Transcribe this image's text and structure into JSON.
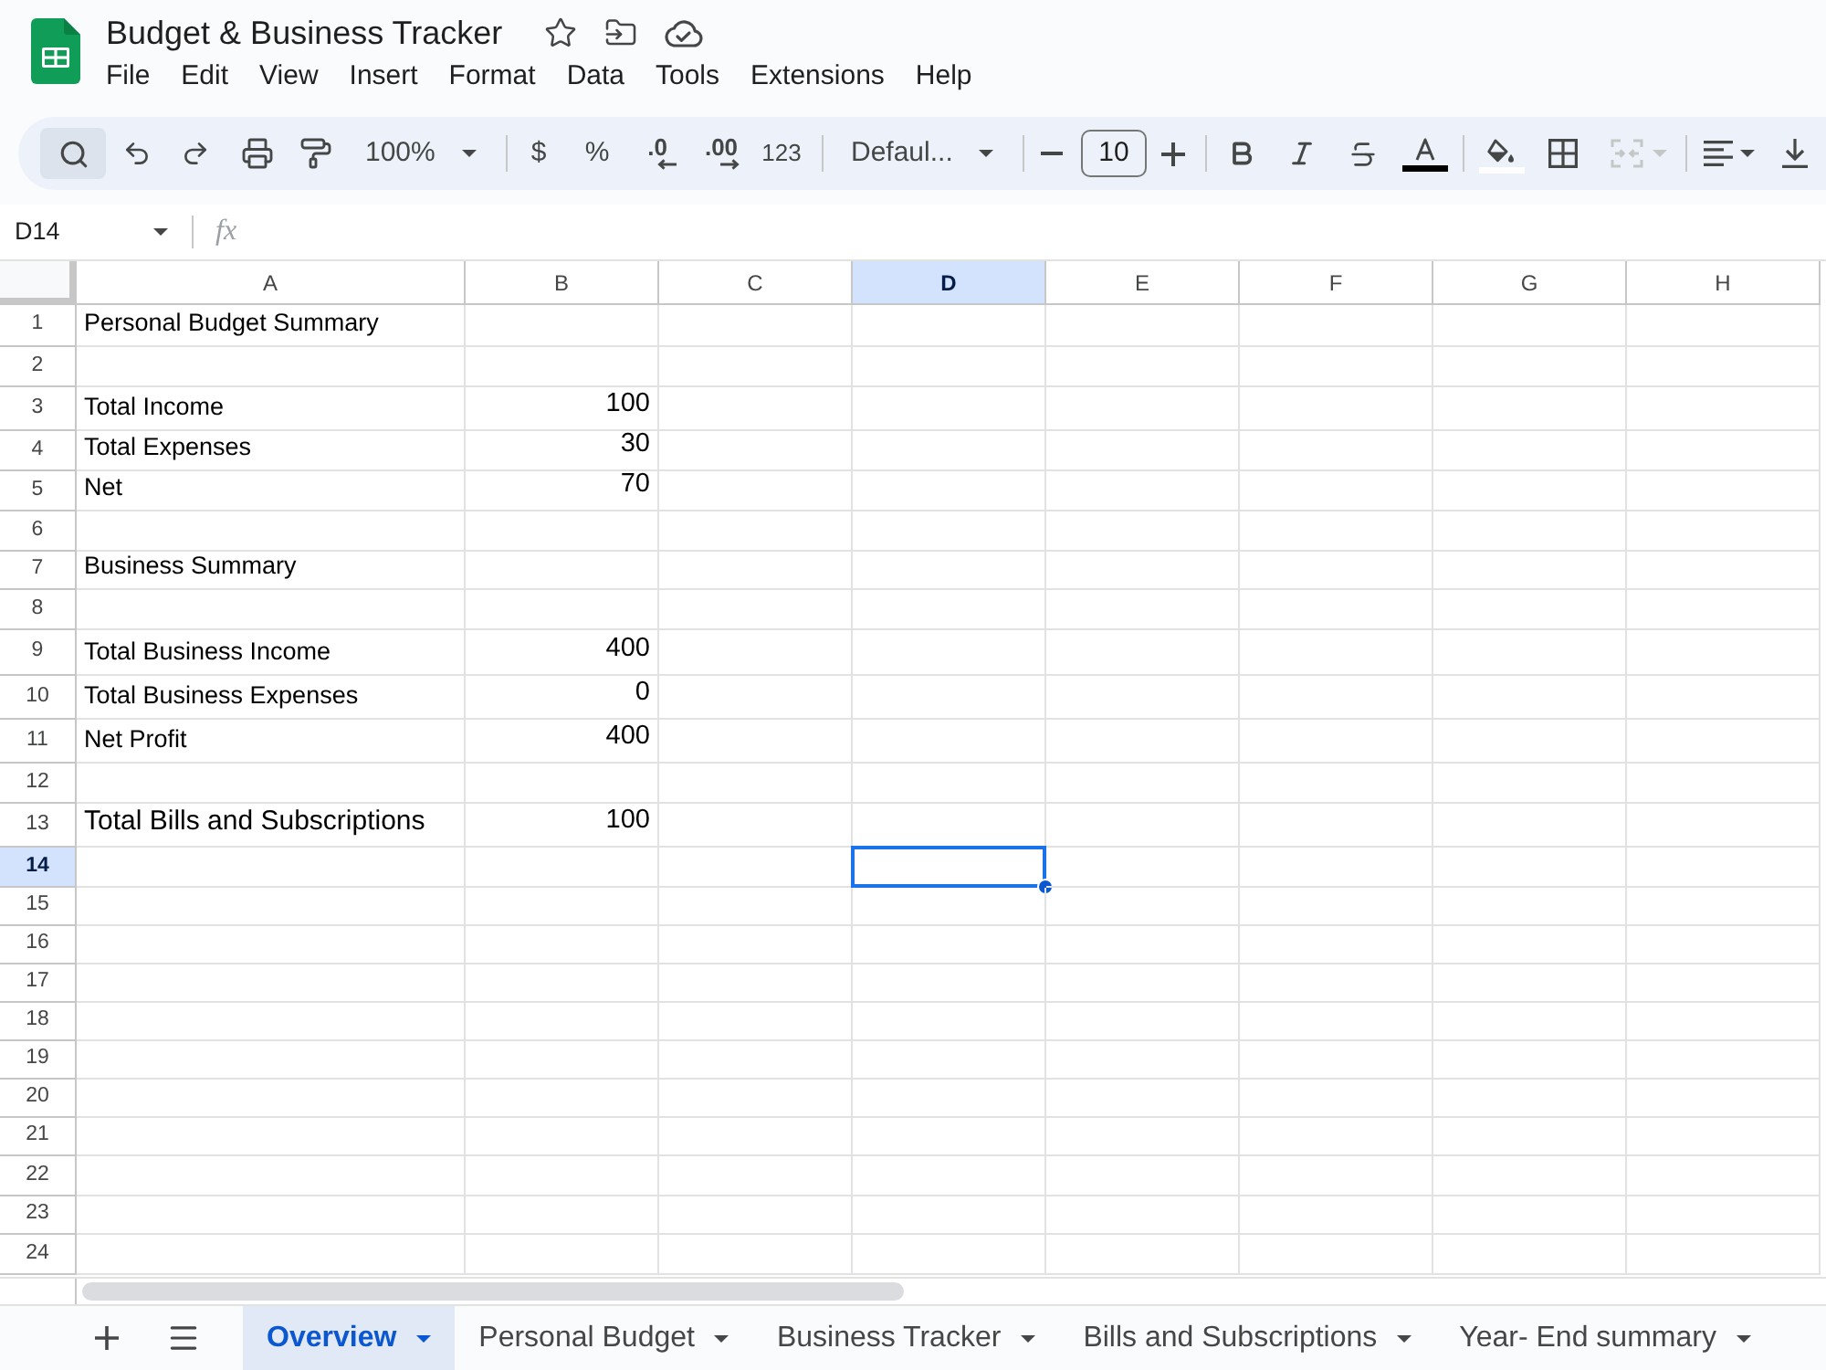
{
  "document": {
    "title": "Budget & Business Tracker"
  },
  "menu": [
    "File",
    "Edit",
    "View",
    "Insert",
    "Format",
    "Data",
    "Tools",
    "Extensions",
    "Help"
  ],
  "toolbar": {
    "search_active": true,
    "zoom": "100%",
    "currency": "$",
    "percent": "%",
    "decrease_decimal": ".0",
    "increase_decimal": ".00",
    "number_format": "123",
    "font": "Defaul...",
    "font_size": "10",
    "merge_disabled": true
  },
  "formula_bar": {
    "name_box": "D14",
    "fx": "fx"
  },
  "columns": [
    {
      "label": "A",
      "selected": false
    },
    {
      "label": "B",
      "selected": false
    },
    {
      "label": "C",
      "selected": false
    },
    {
      "label": "D",
      "selected": true
    },
    {
      "label": "E",
      "selected": false
    },
    {
      "label": "F",
      "selected": false
    },
    {
      "label": "G",
      "selected": false
    },
    {
      "label": "H",
      "selected": false
    }
  ],
  "rows": [
    {
      "label": "1",
      "selected": false,
      "cells": [
        "Personal Budget Summary"
      ]
    },
    {
      "label": "2",
      "selected": false
    },
    {
      "label": "3",
      "selected": false,
      "cells": [
        "Total Income",
        "100"
      ]
    },
    {
      "label": "4",
      "selected": false,
      "cells": [
        "Total Expenses",
        "30"
      ]
    },
    {
      "label": "5",
      "selected": false,
      "cells": [
        "Net",
        "70"
      ]
    },
    {
      "label": "6",
      "selected": false
    },
    {
      "label": "7",
      "selected": false,
      "cells": [
        "Business Summary"
      ]
    },
    {
      "label": "8",
      "selected": false
    },
    {
      "label": "9",
      "selected": false,
      "cells": [
        "Total Business Income",
        "400"
      ]
    },
    {
      "label": "10",
      "selected": false,
      "cells": [
        "Total Business Expenses",
        "0"
      ]
    },
    {
      "label": "11",
      "selected": false,
      "cells": [
        "Net Profit",
        "400"
      ]
    },
    {
      "label": "12",
      "selected": false
    },
    {
      "label": "13",
      "selected": false,
      "cells": [
        "Total Bills and Subscriptions",
        "100"
      ]
    },
    {
      "label": "14",
      "selected": true
    },
    {
      "label": "15",
      "selected": false
    },
    {
      "label": "16",
      "selected": false
    },
    {
      "label": "17",
      "selected": false
    },
    {
      "label": "18",
      "selected": false
    },
    {
      "label": "19",
      "selected": false
    },
    {
      "label": "20",
      "selected": false
    },
    {
      "label": "21",
      "selected": false
    },
    {
      "label": "22",
      "selected": false
    },
    {
      "label": "23",
      "selected": false
    },
    {
      "label": "24",
      "selected": false
    }
  ],
  "sheet_tabs": [
    {
      "label": "Overview",
      "selected": true
    },
    {
      "label": "Personal Budget",
      "selected": false
    },
    {
      "label": "Business Tracker",
      "selected": false
    },
    {
      "label": "Bills and Subscriptions",
      "selected": false
    },
    {
      "label": "Year- End summary",
      "selected": false
    }
  ]
}
